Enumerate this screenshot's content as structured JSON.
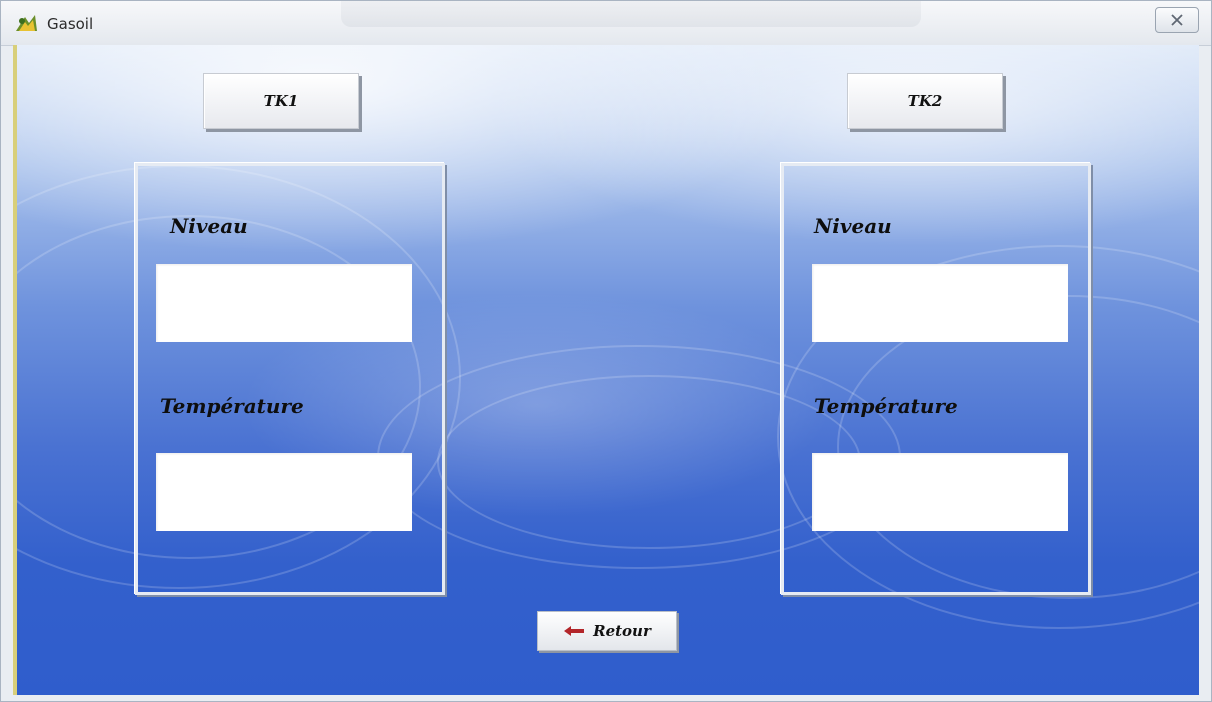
{
  "window": {
    "title": "Gasoil",
    "icon": "gasoil-app-icon",
    "close_icon": "close-icon"
  },
  "tanks": [
    {
      "button_label": "TK1",
      "level_label": "Niveau",
      "level_value": "",
      "temperature_label": "Température",
      "temperature_value": ""
    },
    {
      "button_label": "TK2",
      "level_label": "Niveau",
      "level_value": "",
      "temperature_label": "Température",
      "temperature_value": ""
    }
  ],
  "footer": {
    "back_label": "Retour",
    "back_icon": "arrow-left-icon"
  },
  "colors": {
    "background_top": "#dde8f8",
    "background_bottom": "#2f5dcc",
    "back_arrow": "#b3262a"
  }
}
